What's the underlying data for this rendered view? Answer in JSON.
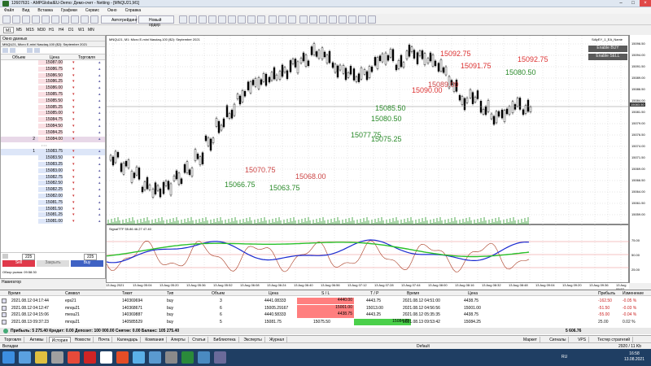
{
  "window": {
    "title": "12607631 - AMPGlobalEU-Demo: Демо-счет - Netting - [MNQU21,M1]"
  },
  "menu": [
    "Файл",
    "Вид",
    "Вставка",
    "Графики",
    "Сервис",
    "Окно",
    "Справка"
  ],
  "toolbar": {
    "autotrade": "Автотрейдинг",
    "neworder": "Новый ордер"
  },
  "timeframes": [
    "M1",
    "M5",
    "M15",
    "M30",
    "H1",
    "H4",
    "D1",
    "W1",
    "MN"
  ],
  "panel": {
    "market_watch": "Окно данных",
    "symbol": "MNQU21, Micro E-mini Nasdaq-100 ($2): September 2021",
    "col_volume": "Объем",
    "col_price": "Цена",
    "col_trade": "Торговля",
    "sell": "Sell",
    "close": "Закрыть",
    "buy": "Buy",
    "qty": "225",
    "dom_title": "Обзор рынка: 09:58:30",
    "navigator": "Навигатор"
  },
  "dom": {
    "asks": [
      "15087.00",
      "15086.75",
      "15086.50",
      "15086.25",
      "15086.00",
      "15085.75",
      "15085.50",
      "15085.25",
      "15085.00",
      "15084.75",
      "15084.50",
      "15084.25",
      "15084.00"
    ],
    "ask_vol": [
      "",
      "",
      "",
      "",
      "",
      "",
      "",
      "",
      "",
      "",
      "",
      "",
      "2"
    ],
    "bids": [
      "15083.75",
      "15083.50",
      "15083.25",
      "15083.00",
      "15082.75",
      "15082.50",
      "15082.25",
      "15082.00",
      "15081.75",
      "15081.50",
      "15081.25",
      "15081.00"
    ],
    "bid_vol": [
      "1",
      "",
      "",
      "",
      "",
      "",
      "",
      "",
      "",
      "",
      "",
      ""
    ]
  },
  "chart": {
    "title": "MNQU21, M1: Micro E-mini Nasdaq-100 ($2): September 2021",
    "ea": "SdlyEY_1_EA_Name",
    "enable_buy": "Enable BUY",
    "enable_sell": "Enable SELL",
    "indicator": "SignalTTF 55.86 46.27 47.40",
    "labels": [
      "15092.75",
      "15091.75",
      "15090.00",
      "15089.00",
      "15085.50",
      "15080.50",
      "15077.75",
      "15075.25",
      "15070.75",
      "15068.00",
      "15066.75",
      "15063.75"
    ],
    "current_price": "15083.50"
  },
  "price_axis": [
    "15096.50",
    "15094.00",
    "15091.50",
    "15089.00",
    "15086.50",
    "15084.00",
    "15081.50",
    "15079.00",
    "15076.50",
    "15074.00",
    "15071.50",
    "15069.00",
    "15066.50",
    "15064.00",
    "15061.50",
    "15059.00"
  ],
  "ind_axis": [
    "75.00",
    "50.00",
    "25.00"
  ],
  "time_axis": [
    "13 Aug 2021",
    "13 Aug 05:04",
    "13 Aug 05:20",
    "13 Aug 05:36",
    "13 Aug 05:52",
    "13 Aug 06:08",
    "13 Aug 06:24",
    "13 Aug 06:40",
    "13 Aug 06:56",
    "13 Aug 07:12",
    "13 Aug 07:28",
    "13 Aug 07:44",
    "13 Aug 08:00",
    "13 Aug 08:16",
    "13 Aug 08:32",
    "13 Aug 08:48",
    "13 Aug 09:04",
    "13 Aug 09:20",
    "13 Aug 09:36",
    "13 Aug 09:52"
  ],
  "terminal": {
    "headers": [
      "Время",
      "Символ",
      "Тикет",
      "Тип",
      "Объем",
      "Цена",
      "S / L",
      "T / P",
      "Время",
      "Цена",
      "Прибыль",
      "Изменение"
    ],
    "rows": [
      {
        "time": "2021.08.12 04:17:44",
        "symbol": "eps21",
        "ticket": "140369694",
        "type": "buy",
        "volume": "3",
        "price": "4441.08333",
        "sl": "4440.00",
        "tp": "4443.75",
        "time2": "2021.08.12 04:51:00",
        "price2": "4438.75",
        "profit": "-162.50",
        "change": "-0.05 %"
      },
      {
        "time": "2021.08.12 04:12:47",
        "symbol": "mnqu21",
        "ticket": "140368671",
        "type": "buy",
        "volume": "6",
        "price": "15005.29167",
        "sl": "15001.00",
        "tp": "15013.00",
        "time2": "2021.08.12 04:56:56",
        "price2": "15001.00",
        "profit": "-51.50",
        "change": "-0.03 %"
      },
      {
        "time": "2021.08.12 04:15:06",
        "symbol": "mesu21",
        "ticket": "140369887",
        "type": "buy",
        "volume": "6",
        "price": "4440.58333",
        "sl": "4438.75",
        "tp": "4443.25",
        "time2": "2021.08.12 05:35:35",
        "price2": "4438.75",
        "profit": "-55.00",
        "change": "-0.04 %"
      },
      {
        "time": "2021.08.13 09:37:23",
        "symbol": "mnqu21",
        "ticket": "140585529",
        "type": "buy",
        "volume": "5",
        "price": "15081.75",
        "sl": "15075.50",
        "tp": "15084.25",
        "time2": "2021.08.13 09:53:42",
        "price2": "15084.25",
        "profit": "25.00",
        "change": "0.02 %"
      }
    ],
    "balance": "Прибыль: 5 275.40  Кредит: 0.00  Депозит: 100 000.00  Снятие: 0.00  Баланс: 105 275.40",
    "balance_total": "5 606.76"
  },
  "tabs": [
    "Торговля",
    "Активы",
    "История",
    "Новости",
    "Почта",
    "Календарь",
    "Компания",
    "Алерты",
    "Статьи",
    "Библиотека",
    "Эксперты",
    "Журнал"
  ],
  "tabs_right": [
    "Маркет",
    "Сигналы",
    "VPS",
    "Тестер стратегий"
  ],
  "status": {
    "left": "Вкладки",
    "center": "Default",
    "right": "2920 / 11 Kb"
  },
  "clock": {
    "time": "16:58",
    "date": "13.08.2021",
    "lang": "RU"
  }
}
